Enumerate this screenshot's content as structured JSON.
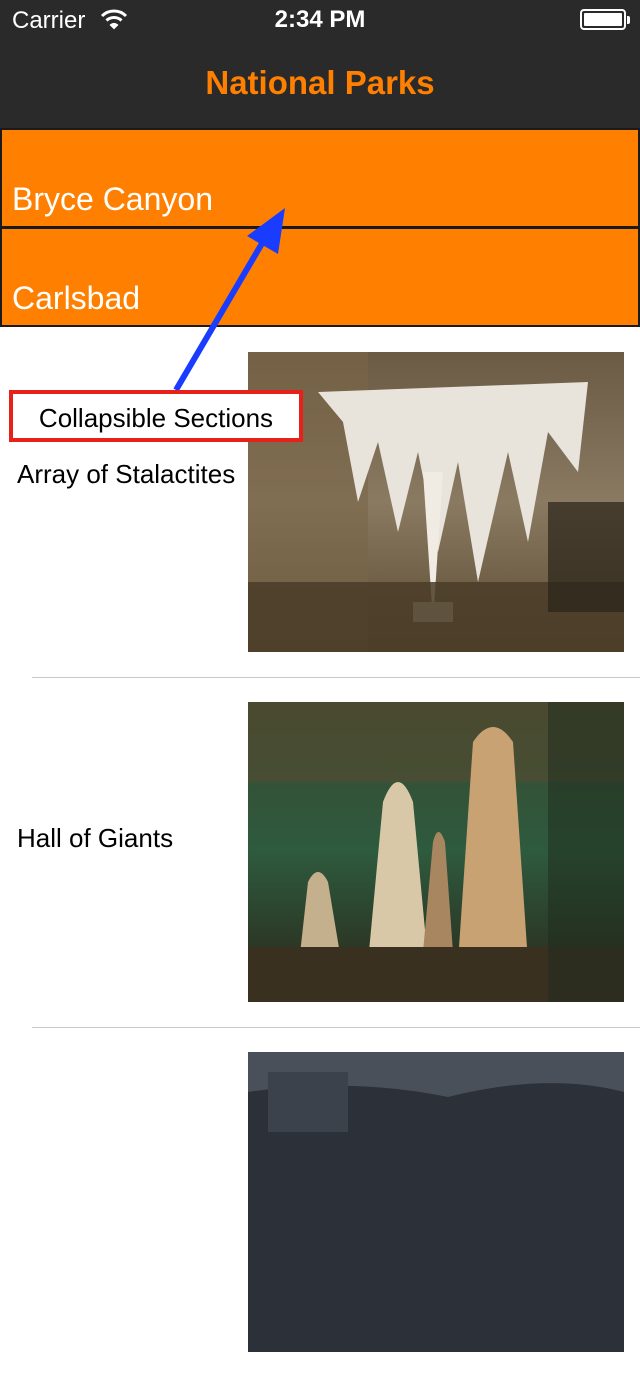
{
  "status_bar": {
    "carrier": "Carrier",
    "time": "2:34 PM"
  },
  "nav": {
    "title": "National Parks"
  },
  "sections": [
    {
      "label": "Bryce Canyon"
    },
    {
      "label": "Carlsbad"
    }
  ],
  "rows": [
    {
      "title": "Array of Stalactites",
      "image": "cave-stalactites-photo"
    },
    {
      "title": "Hall of Giants",
      "image": "cave-hall-of-giants-photo"
    },
    {
      "title": "",
      "image": "cave-dark-photo"
    }
  ],
  "annotation": {
    "label": "Collapsible Sections",
    "color": "#e8201a",
    "arrow_color": "#1a3cff"
  },
  "colors": {
    "accent": "#ff8000",
    "bar": "#2a2a2a"
  }
}
